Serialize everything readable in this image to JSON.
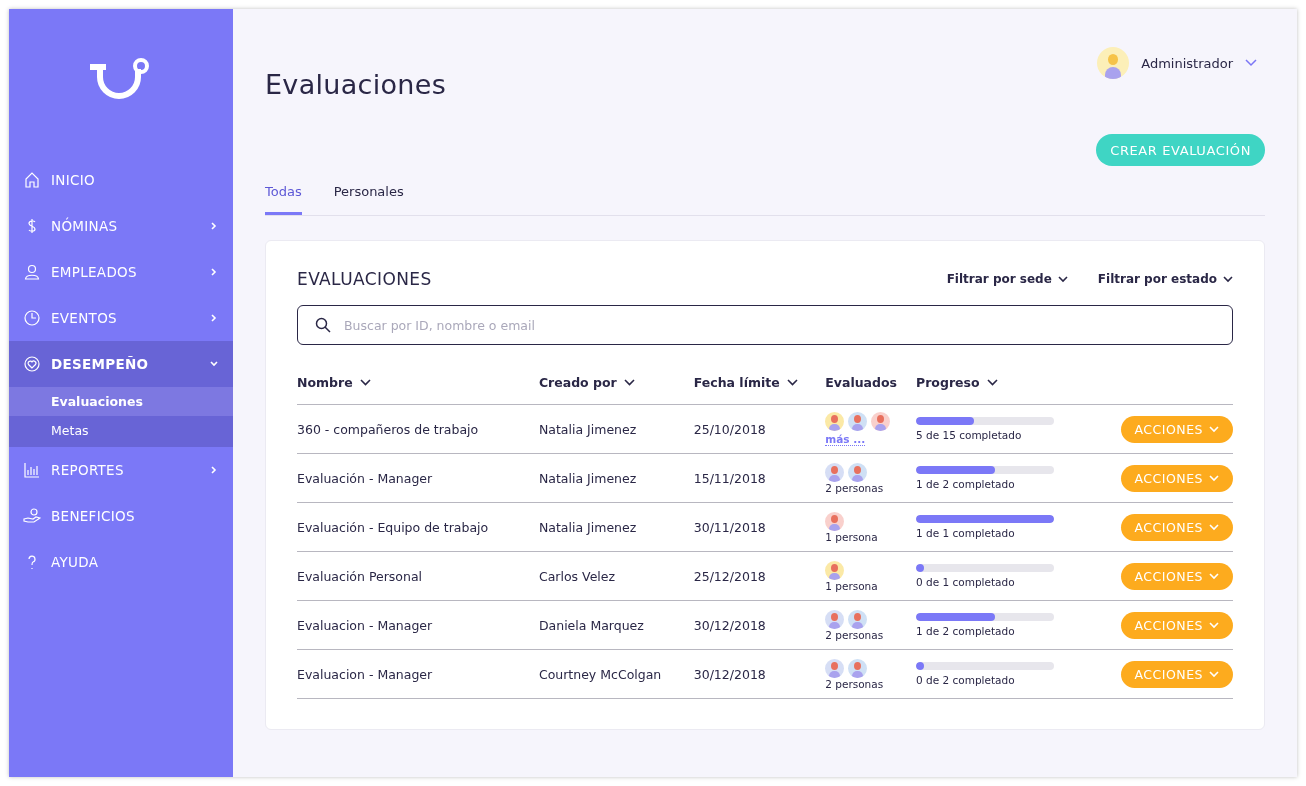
{
  "sidebar": {
    "items": [
      {
        "label": "INICIO",
        "chevron": false,
        "expanded": false,
        "selected": false
      },
      {
        "label": "NÓMINAS",
        "chevron": true,
        "expanded": false,
        "selected": false
      },
      {
        "label": "EMPLEADOS",
        "chevron": true,
        "expanded": false,
        "selected": false
      },
      {
        "label": "EVENTOS",
        "chevron": true,
        "expanded": false,
        "selected": false
      },
      {
        "label": "DESEMPEÑO",
        "chevron": true,
        "expanded": true,
        "selected": true,
        "children": [
          {
            "label": "Evaluaciones",
            "selected": true
          },
          {
            "label": "Metas",
            "selected": false
          }
        ]
      },
      {
        "label": "REPORTES",
        "chevron": true,
        "expanded": false,
        "selected": false
      },
      {
        "label": "BENEFICIOS",
        "chevron": false,
        "expanded": false,
        "selected": false
      },
      {
        "label": "AYUDA",
        "chevron": false,
        "expanded": false,
        "selected": false
      }
    ]
  },
  "user": {
    "name": "Administrador"
  },
  "page": {
    "title": "Evaluaciones",
    "create_button": "CREAR EVALUACIÓN"
  },
  "tabs": [
    {
      "label": "Todas",
      "selected": true
    },
    {
      "label": "Personales",
      "selected": false
    }
  ],
  "card": {
    "title": "EVALUACIONES",
    "filters": [
      "Filtrar por sede",
      "Filtrar por estado"
    ],
    "search": {
      "placeholder": "Buscar por ID, nombre o email"
    }
  },
  "table": {
    "columns": [
      {
        "label": "Nombre",
        "sortable": true
      },
      {
        "label": "Creado por",
        "sortable": true
      },
      {
        "label": "Fecha límite",
        "sortable": true
      },
      {
        "label": "Evaluados",
        "sortable": false
      },
      {
        "label": "Progreso",
        "sortable": true
      }
    ],
    "rows": [
      {
        "name": "360 - compañeros de trabajo",
        "creator": "Natalia Jimenez",
        "deadline": "25/10/2018",
        "avatars": [
          {
            "color": "#fbe9a6"
          },
          {
            "color": "#cfe0f5"
          },
          {
            "color": "#f9d0cc"
          }
        ],
        "evaluated": "más ...",
        "evaluated_link": true,
        "level": 0.42,
        "progress": "5 de 15 completado",
        "action": "ACCIONES"
      },
      {
        "name": "Evaluación - Manager",
        "creator": "Natalia Jimenez",
        "deadline": "15/11/2018",
        "avatars": [
          {
            "color": "#d6def5"
          },
          {
            "color": "#cfe0f5"
          }
        ],
        "evaluated": "2 personas",
        "evaluated_link": false,
        "level": 0.57,
        "progress": "1 de 2 completado",
        "action": "ACCIONES"
      },
      {
        "name": "Evaluación - Equipo de trabajo",
        "creator": "Natalia Jimenez",
        "deadline": "30/11/2018",
        "avatars": [
          {
            "color": "#f9d0cc"
          }
        ],
        "evaluated": "1 persona",
        "evaluated_link": false,
        "level": 1,
        "progress": "1 de 1 completado",
        "action": "ACCIONES"
      },
      {
        "name": "Evaluación Personal",
        "creator": "Carlos Velez",
        "deadline": "25/12/2018",
        "avatars": [
          {
            "color": "#fbe9a6"
          }
        ],
        "evaluated": "1 persona",
        "evaluated_link": false,
        "level": 0.05,
        "progress": "0 de 1 completado",
        "action": "ACCIONES"
      },
      {
        "name": "Evaluacion - Manager",
        "creator": "Daniela Marquez",
        "deadline": "30/12/2018",
        "avatars": [
          {
            "color": "#d6def5"
          },
          {
            "color": "#cfe0f5"
          }
        ],
        "evaluated": "2 personas",
        "evaluated_link": false,
        "level": 0.57,
        "progress": "1 de 2 completado",
        "action": "ACCIONES"
      },
      {
        "name": "Evaluacion - Manager",
        "creator": "Courtney McColgan",
        "deadline": "30/12/2018",
        "avatars": [
          {
            "color": "#d6def5"
          },
          {
            "color": "#cfe0f5"
          }
        ],
        "evaluated": "2 personas",
        "evaluated_link": false,
        "level": 0.05,
        "progress": "0 de 2 completado",
        "action": "ACCIONES"
      }
    ]
  }
}
